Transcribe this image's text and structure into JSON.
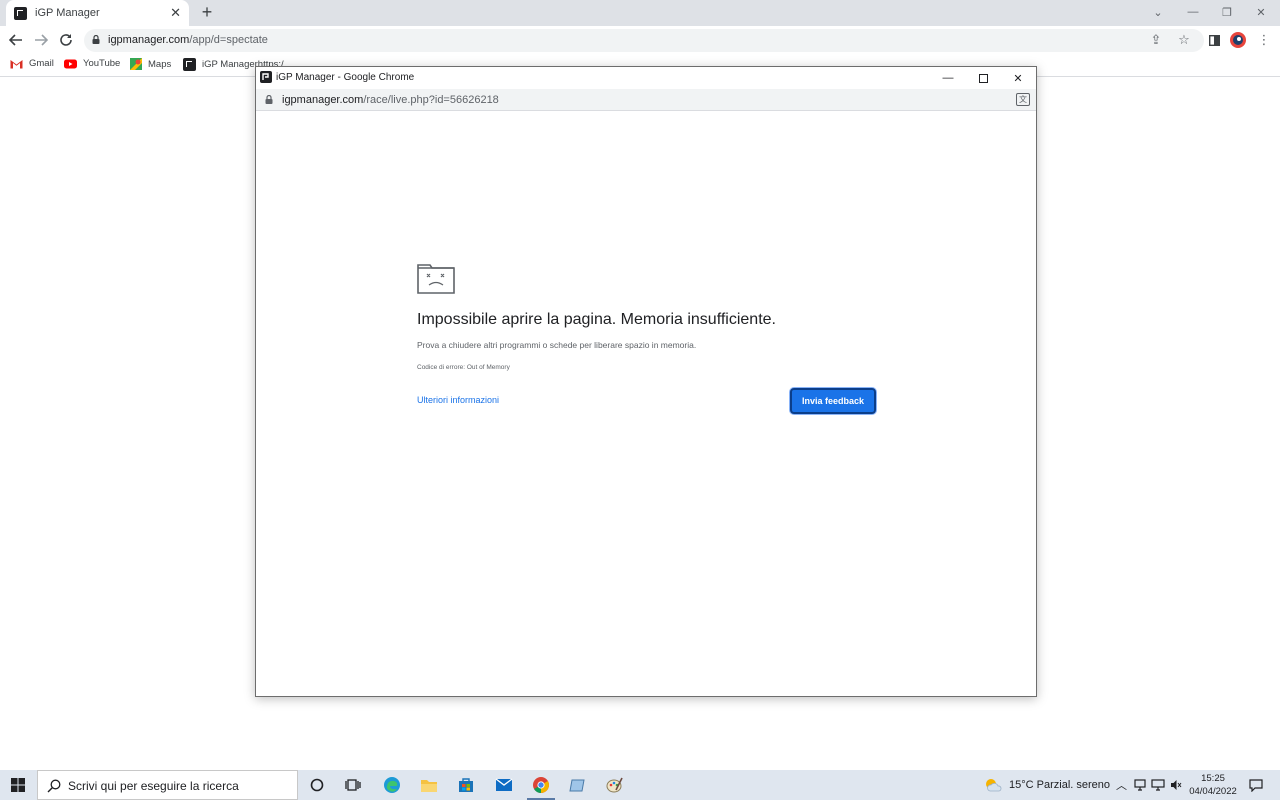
{
  "browser": {
    "tab_title": "iGP Manager",
    "tab_close": "✕",
    "new_tab": "+",
    "url_host": "igpmanager.com",
    "url_path": "/app/d=spectate",
    "window_controls": {
      "dropdown": "⌄",
      "minimize": "—",
      "restore": "❐",
      "close": "✕"
    }
  },
  "bookmarks": [
    {
      "label": "Gmail",
      "icon": "gmail-icon"
    },
    {
      "label": "YouTube",
      "icon": "youtube-icon"
    },
    {
      "label": "Maps",
      "icon": "maps-icon"
    },
    {
      "label": "iGP Managerhttps:/",
      "icon": "igp-icon"
    }
  ],
  "popup": {
    "title": "iGP Manager - Google Chrome",
    "url_host": "igpmanager.com",
    "url_path": "/race/live.php?id=56626218",
    "error": {
      "title": "Impossibile aprire la pagina. Memoria insufficiente.",
      "description": "Prova a chiudere altri programmi o schede per liberare spazio in memoria.",
      "code": "Codice di errore: Out of Memory",
      "more_info_link": "Ulteriori informazioni",
      "feedback_button": "Invia feedback"
    }
  },
  "taskbar": {
    "search_placeholder": "Scrivi qui per eseguire la ricerca",
    "weather": "15°C  Parzial. sereno",
    "time": "15:25",
    "date": "04/04/2022"
  },
  "colors": {
    "accent_blue": "#1a73e8",
    "tabstrip_bg": "#dee1e6",
    "taskbar_bg": "#dfe6ef"
  }
}
